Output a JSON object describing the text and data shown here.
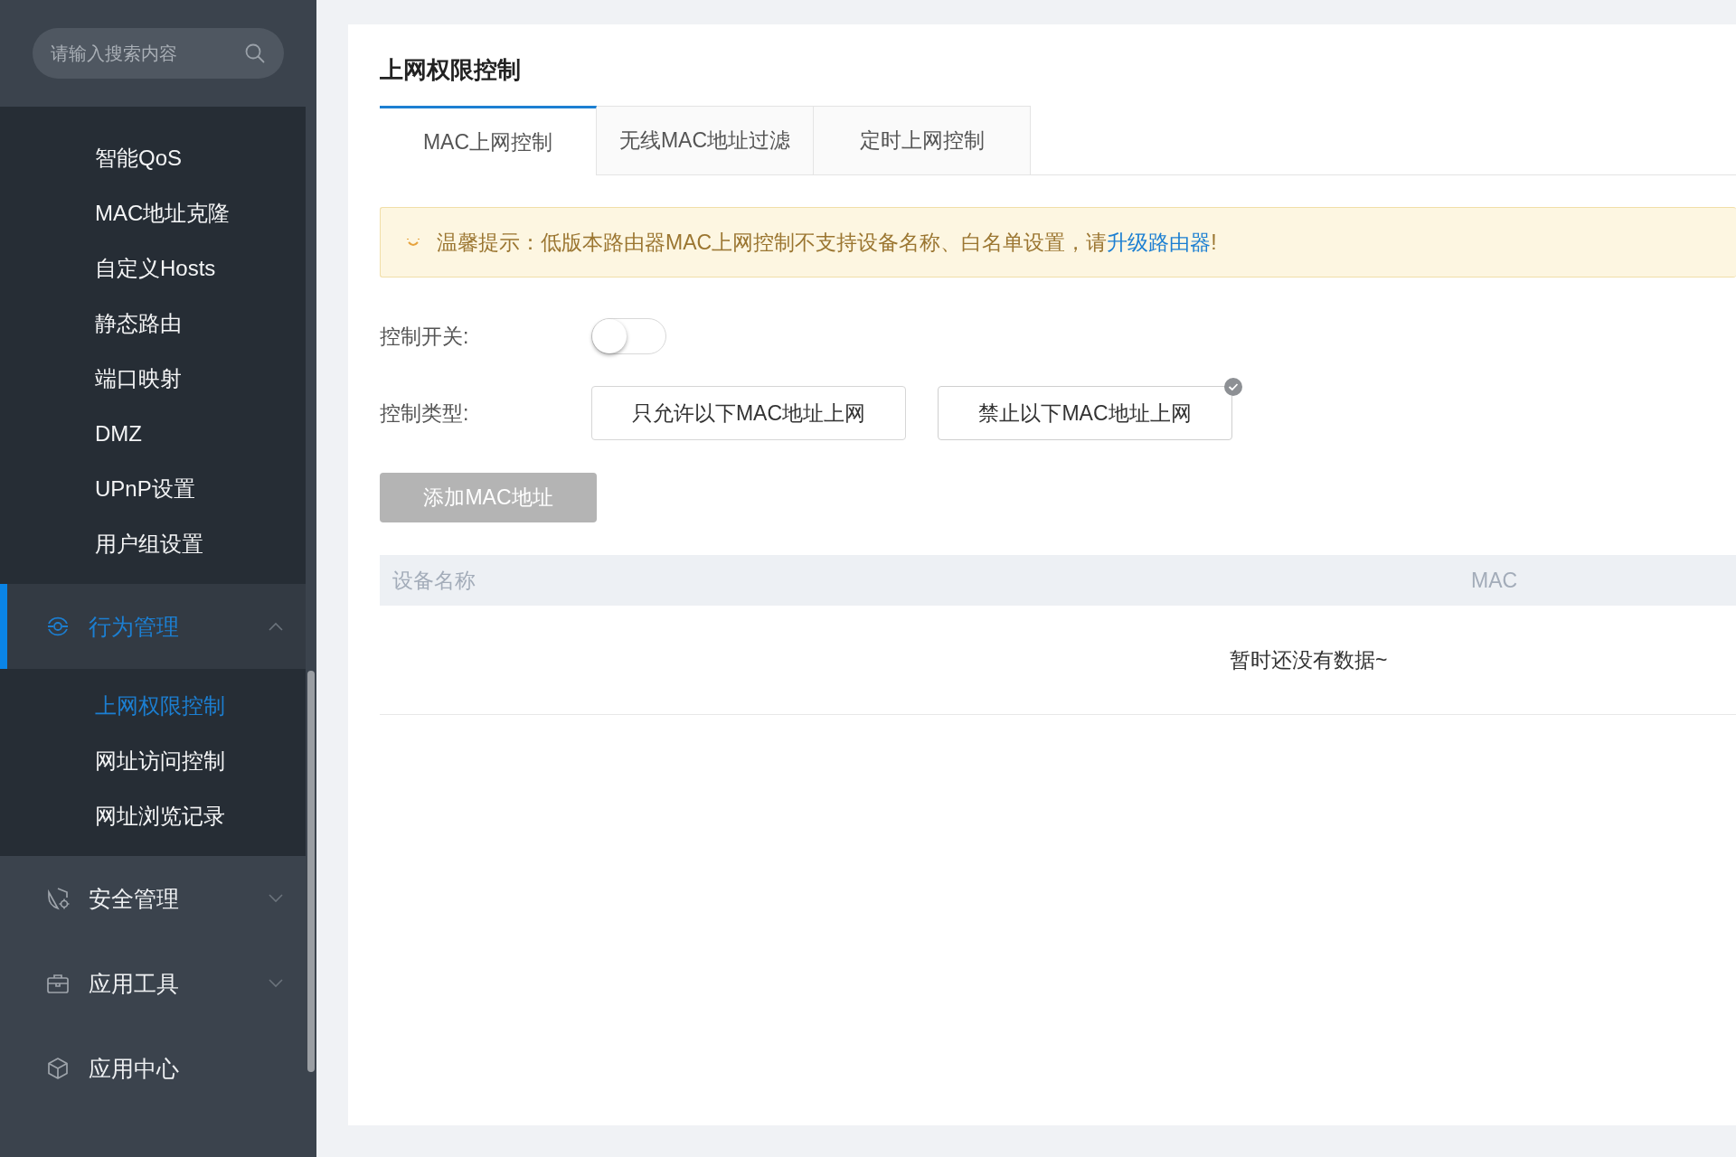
{
  "sidebar": {
    "search": {
      "placeholder": "请输入搜索内容"
    },
    "items": [
      {
        "label": "智能QoS",
        "selected": false
      },
      {
        "label": "MAC地址克隆",
        "selected": false
      },
      {
        "label": "自定义Hosts",
        "selected": false
      },
      {
        "label": "静态路由",
        "selected": false
      },
      {
        "label": "端口映射",
        "selected": false
      },
      {
        "label": "DMZ",
        "selected": false
      },
      {
        "label": "UPnP设置",
        "selected": false
      },
      {
        "label": "用户组设置",
        "selected": false
      }
    ],
    "groups": [
      {
        "label": "行为管理",
        "selected": true,
        "expanded": true,
        "children": [
          {
            "label": "上网权限控制",
            "selected": true
          },
          {
            "label": "网址访问控制",
            "selected": false
          },
          {
            "label": "网址浏览记录",
            "selected": false
          }
        ]
      },
      {
        "label": "安全管理",
        "selected": false,
        "expanded": false
      },
      {
        "label": "应用工具",
        "selected": false,
        "expanded": false
      },
      {
        "label": "应用中心",
        "selected": false
      }
    ]
  },
  "page": {
    "title": "上网权限控制",
    "tabs": [
      {
        "label": "MAC上网控制",
        "selected": true
      },
      {
        "label": "无线MAC地址过滤",
        "selected": false
      },
      {
        "label": "定时上网控制",
        "selected": false
      }
    ],
    "notice": {
      "text": "温馨提示：低版本路由器MAC上网控制不支持设备名称、白名单设置，请",
      "link": "升级路由器",
      "suffix": "!"
    },
    "switch": {
      "label": "控制开关:",
      "on": false
    },
    "control_type": {
      "label": "控制类型:",
      "options": [
        {
          "label": "只允许以下MAC地址上网",
          "selected": false
        },
        {
          "label": "禁止以下MAC地址上网",
          "selected": true
        }
      ]
    },
    "add_button": {
      "label": "添加MAC地址",
      "disabled": true
    },
    "table": {
      "columns": [
        "设备名称",
        "MAC"
      ],
      "empty_text": "暂时还没有数据~"
    }
  }
}
